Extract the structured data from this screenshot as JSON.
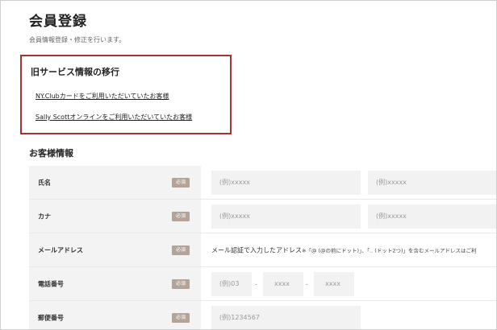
{
  "page": {
    "title": "会員登録",
    "subtitle": "会員情報登録・修正を行います。"
  },
  "migration": {
    "title": "旧サービス情報の移行",
    "links": [
      "NY.Clubカードをご利用いただいていたお客様",
      "Sally Scottオンラインをご利用いただいていたお客様"
    ]
  },
  "customer_info": {
    "title": "お客様情報",
    "required_label": "必須",
    "name": {
      "label": "氏名",
      "placeholder_last": "(例)xxxxx",
      "placeholder_first": "(例)xxxxx"
    },
    "kana": {
      "label": "カナ",
      "placeholder_last": "(例)xxxxx",
      "placeholder_first": "(例)xxxxx"
    },
    "email": {
      "label": "メールアドレス",
      "note_main": "メール認証で入力したアドレス",
      "note_small": "※「@ (@の前にドット)」、「.. (ドット2つ)」を含むメールアドレスはご利"
    },
    "phone": {
      "label": "電話番号",
      "placeholder_1": "(例)03",
      "placeholder_2": "xxxx",
      "placeholder_3": "xxxx",
      "separator": "-"
    },
    "postal": {
      "label": "郵便番号",
      "placeholder": "(例)1234567"
    }
  },
  "colors": {
    "highlight_border": "#a63232",
    "required_badge": "#b4a398",
    "label_background": "#f3f3f3",
    "input_background": "#f2f2f2"
  }
}
